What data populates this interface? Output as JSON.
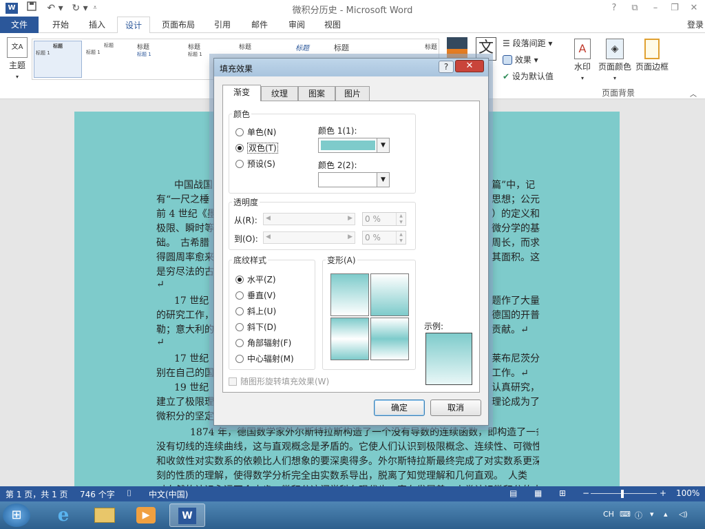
{
  "window": {
    "title": "微积分历史 - Microsoft Word",
    "app_icon_label": "W",
    "qat": {
      "save_icon": "save-icon",
      "undo_icon": "undo-icon",
      "redo_icon": "redo-icon"
    },
    "controls": [
      "?",
      "⧉",
      "–",
      "❐",
      "✕"
    ]
  },
  "ribbon_tabs": {
    "file": "文件",
    "items": [
      "开始",
      "插入",
      "设计",
      "页面布局",
      "引用",
      "邮件",
      "审阅",
      "视图"
    ],
    "active": "设计",
    "login": "登录"
  },
  "ribbon": {
    "theme_label": "主题",
    "style_thumbs": [
      {
        "heading": "标题",
        "sub": "标题 1"
      },
      {
        "heading": "标题",
        "sub": "标题 1"
      },
      {
        "heading": "标题",
        "sub": "标题 1"
      },
      {
        "heading": "标题",
        "sub": "标题 1"
      },
      {
        "heading": "标题",
        "sub": ""
      },
      {
        "heading": "标题",
        "sub": ""
      },
      {
        "heading": "标题",
        "sub": ""
      },
      {
        "heading": "标题",
        "sub": ""
      }
    ],
    "paragraph_spacing": "段落间距",
    "effects": "效果",
    "set_default": "设为默认值",
    "watermark": "水印",
    "page_color": "页面颜色",
    "page_border": "页面边框",
    "group_page_background": "页面背景"
  },
  "document": {
    "left_lines": [
      "中国战国",
      "有“一尺之棰",
      "前 4 世纪《墨",
      "极限、瞬时等",
      "础。　古希腊",
      "得圆周率愈来",
      "是穷尽法的古",
      "↵",
      "17 世纪",
      "的研究工作，",
      "勒；意大利的",
      "↵",
      "17 世纪",
      "别在自己的国",
      "19 世纪",
      "建立了极限理",
      "微积分的坚定"
    ],
    "right_lines": [
      "篇”中，记",
      "思想；公元",
      "）的定义和",
      "微分学的基",
      "周长，而求",
      "其面积。这",
      "",
      "",
      "题作了大量",
      "德国的开普",
      "贡献。↵",
      "",
      "莱布尼茨分",
      "工作。↵",
      "认真研究，",
      "理论成为了",
      ""
    ],
    "full_lines": [
      "1874 年，德国数学家外尔斯特拉斯构造了一个没有导数的连续函数，即构造了一条",
      "没有切线的连续曲线，这与直观概念是矛盾的。它使人们认识到极限概念、连续性、可微性",
      "和收敛性对实数系的依赖比人们想象的要深奥得多。外尔斯特拉斯最终完成了对实数系更深",
      "刻的性质的理解，使得数学分析完全由实数系导出，脱离了知觉理解和几何直观。　人类",
      "对自然的认识永远不会止步，微积分这门学科在现代也一直在发展着。人类认识微积分的水"
    ]
  },
  "dialog": {
    "title": "填充效果",
    "help": "?",
    "close": "✕",
    "tabs": [
      "渐变",
      "纹理",
      "图案",
      "图片"
    ],
    "active_tab": "渐变",
    "colors_group": "颜色",
    "color_options": [
      "单色(N)",
      "双色(T)",
      "预设(S)"
    ],
    "color_selected": "双色(T)",
    "color1_label": "颜色 1(1):",
    "color1_value": "#7ecbcb",
    "color2_label": "颜色 2(2):",
    "transparency_group": "透明度",
    "from_label": "从(R):",
    "to_label": "到(O):",
    "from_value": "0 %",
    "to_value": "0 %",
    "shading_group": "底纹样式",
    "shading_options": [
      "水平(Z)",
      "垂直(V)",
      "斜上(U)",
      "斜下(D)",
      "角部辐射(F)",
      "中心辐射(M)"
    ],
    "shading_selected": "水平(Z)",
    "variants_group": "变形(A)",
    "sample_label": "示例:",
    "rotate_check": "随图形旋转填充效果(W)",
    "ok": "确定",
    "cancel": "取消"
  },
  "statusbar": {
    "page": "第 1 页，共 1 页",
    "words": "746 个字",
    "language": "中文(中国)",
    "zoom": "100%"
  },
  "taskbar": {
    "tray_lang": "CH"
  },
  "colors": {
    "accent": "#2b579a",
    "page_fill": "#7ecbcb"
  }
}
